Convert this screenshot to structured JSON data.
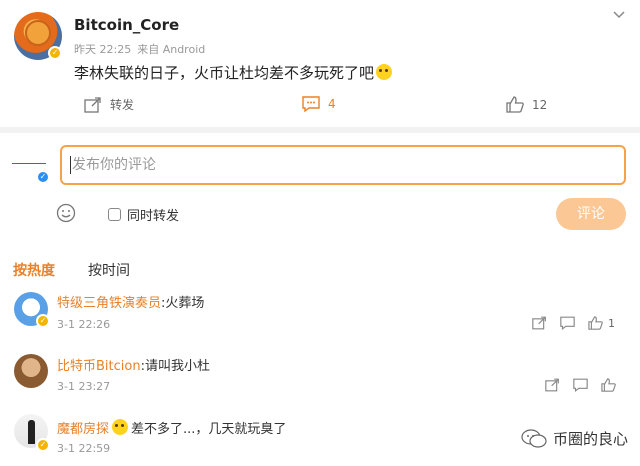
{
  "post": {
    "username": "Bitcoin_Core",
    "time": "昨天 22:25",
    "source": "来自 Android",
    "text": "李林失联的日子，火币让杜均差不多玩死了吧",
    "emoji": "dog-face-emoji",
    "actions": {
      "share_label": "转发",
      "comment_count": "4",
      "like_count": "12"
    }
  },
  "composer": {
    "placeholder": "发布你的评论",
    "repost_label": "同时转发",
    "submit_label": "评论"
  },
  "sort_tabs": {
    "hot": "按热度",
    "time": "按时间"
  },
  "comments": [
    {
      "name": "特级三角铁演奏员",
      "text": ":火葬场",
      "time": "3-1 22:26",
      "like_count": "1"
    },
    {
      "name": "比特币Bitcion",
      "text": ":请叫我小杜",
      "time": "3-1 23:27",
      "like_count": ""
    },
    {
      "name": "魔都房探",
      "text": "差不多了...，几天就玩臭了",
      "time": "3-1 22:59",
      "like_count": ""
    }
  ],
  "watermark": {
    "text": "币圈的良心"
  },
  "colors": {
    "accent": "#e8812a",
    "composer_border": "#f5a24b",
    "submit_bg": "#fbc795",
    "badge": "#f5b400"
  }
}
